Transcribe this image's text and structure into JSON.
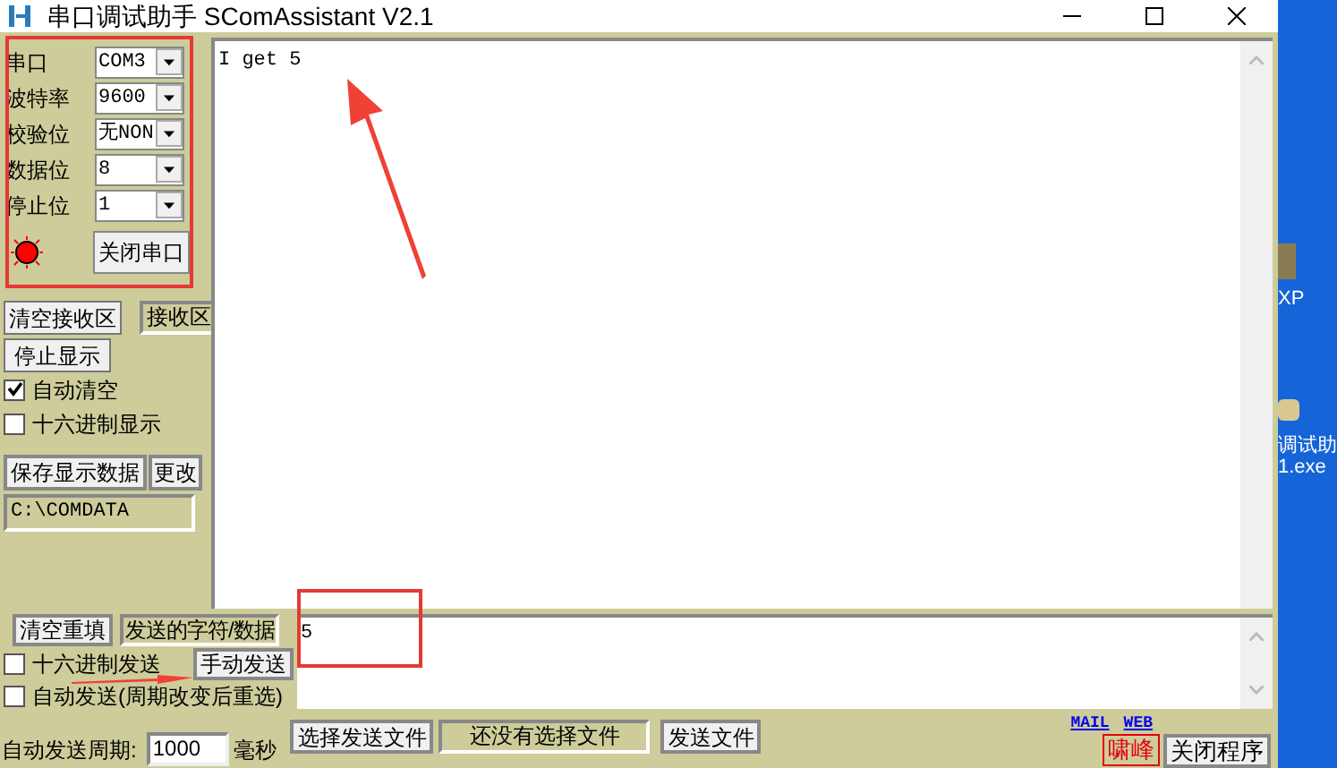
{
  "window": {
    "title": "串口调试助手 SComAssistant V2.1"
  },
  "port_settings": [
    {
      "label": "串口",
      "value": "COM3"
    },
    {
      "label": "波特率",
      "value": "9600"
    },
    {
      "label": "校验位",
      "value": "无NON"
    },
    {
      "label": "数据位",
      "value": "8"
    },
    {
      "label": "停止位",
      "value": "1"
    }
  ],
  "port_led": {
    "on": true
  },
  "close_port_button": "关闭串口",
  "clear_receive_button": "清空接收区",
  "receive_label": "接收区",
  "stop_display_button": "停止显示",
  "receive_options": [
    {
      "label": "自动清空",
      "checked": true
    },
    {
      "label": "十六进制显示",
      "checked": false
    }
  ],
  "save_button": "保存显示数据",
  "change_button": "更改",
  "save_path": "C:\\COMDATA",
  "receive_text": "I get 5",
  "clear_send_button": "清空重填",
  "send_label": "发送的字符/数据",
  "hex_send": {
    "label": "十六进制发送",
    "checked": false
  },
  "manual_send_button": "手动发送",
  "auto_send": {
    "label": "自动发送(周期改变后重选)",
    "checked": false
  },
  "send_text": "5",
  "period_label": "自动发送周期:",
  "period_value": "1000",
  "period_unit": "毫秒",
  "choose_file_button": "选择发送文件",
  "file_status": "还没有选择文件",
  "send_file_button": "发送文件",
  "links": [
    "MAIL",
    "WEB"
  ],
  "author_label": "啸峰",
  "exit_button": "关闭程序",
  "desktop_labels": [
    "XP",
    "调试助",
    "1.exe"
  ]
}
